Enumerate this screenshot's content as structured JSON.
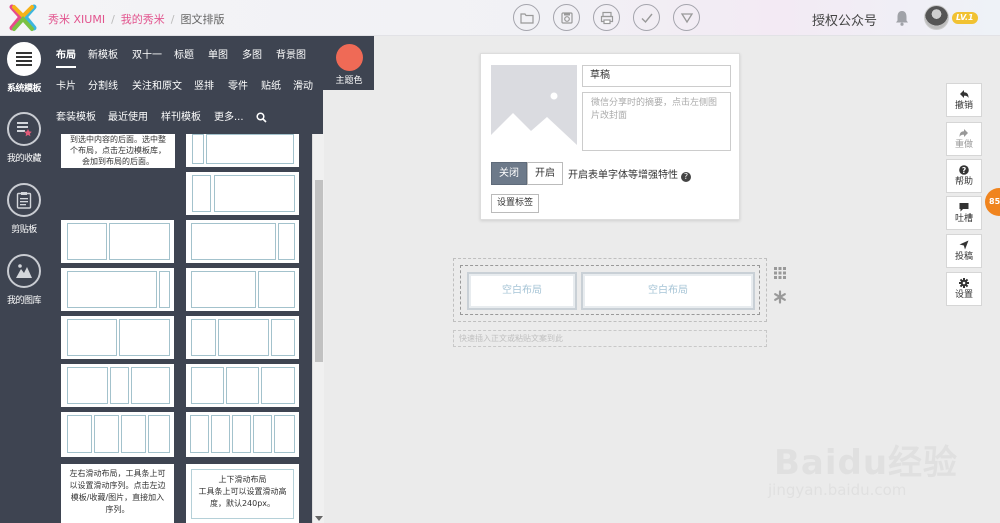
{
  "breadcrumb": {
    "app": "秀米 XIUMI",
    "section": "我的秀米",
    "page": "图文排版"
  },
  "header": {
    "auth_label": "授权公众号",
    "level_badge": "LV.1"
  },
  "top_icons": [
    "folder-icon",
    "save-to-cloud-icon",
    "print-icon",
    "check-icon",
    "triangle-down-icon"
  ],
  "sidebar": {
    "items": [
      {
        "label": "系统模板",
        "icon": "list-icon",
        "active": true
      },
      {
        "label": "我的收藏",
        "icon": "favorites-icon"
      },
      {
        "label": "剪贴板",
        "icon": "clipboard-icon"
      },
      {
        "label": "我的图库",
        "icon": "gallery-icon"
      }
    ]
  },
  "panel": {
    "row1": [
      "布局",
      "新模板",
      "双十一",
      "标题",
      "单图",
      "多图",
      "背景图"
    ],
    "row2": [
      "卡片",
      "分割线",
      "关注和原文",
      "竖排",
      "零件",
      "贴纸",
      "滑动"
    ],
    "row3": [
      "套装模板",
      "最近使用",
      "样刊模板",
      "更多..."
    ],
    "active_tab": "布局",
    "theme_label": "主题色",
    "theme_color": "#ef6a56"
  },
  "templates": {
    "top_text": "到选中内容的后面。选中整个布局，点击左边模板库，会加到布局的后面。",
    "slide_lr_text": "左右滑动布局，工具条上可以设置滑动序列。点击左边模板/收藏/图片，直接加入序列。",
    "slide_ud_text_1": "上下滑动布局",
    "slide_ud_text_2": "工具条上可以设置滑动高度，默认240px。"
  },
  "editor": {
    "title_value": "草稿",
    "summary_placeholder": "微信分享时的摘要，点击左侧图片改封面",
    "toggle_off": "关闭",
    "toggle_on": "开启",
    "feature_text": "开启表单字体等增强特性",
    "help_mark": "?",
    "tag_button": "设置标签",
    "blank_cell_1": "空白布局",
    "blank_cell_2": "空白布局",
    "paste_hint": "快速插入正文或粘贴文案到此"
  },
  "right_toolbar": [
    {
      "label": "撤销",
      "icon": "undo-icon"
    },
    {
      "label": "重做",
      "icon": "redo-icon",
      "disabled": true
    },
    {
      "label": "帮助",
      "icon": "help-icon"
    },
    {
      "label": "吐槽",
      "icon": "comment-icon"
    },
    {
      "label": "投稿",
      "icon": "send-icon"
    },
    {
      "label": "设置",
      "icon": "gear-icon"
    }
  ],
  "side_badge": "85",
  "watermark": {
    "brand": "Baidu经验",
    "url": "jingyan.baidu.com"
  }
}
